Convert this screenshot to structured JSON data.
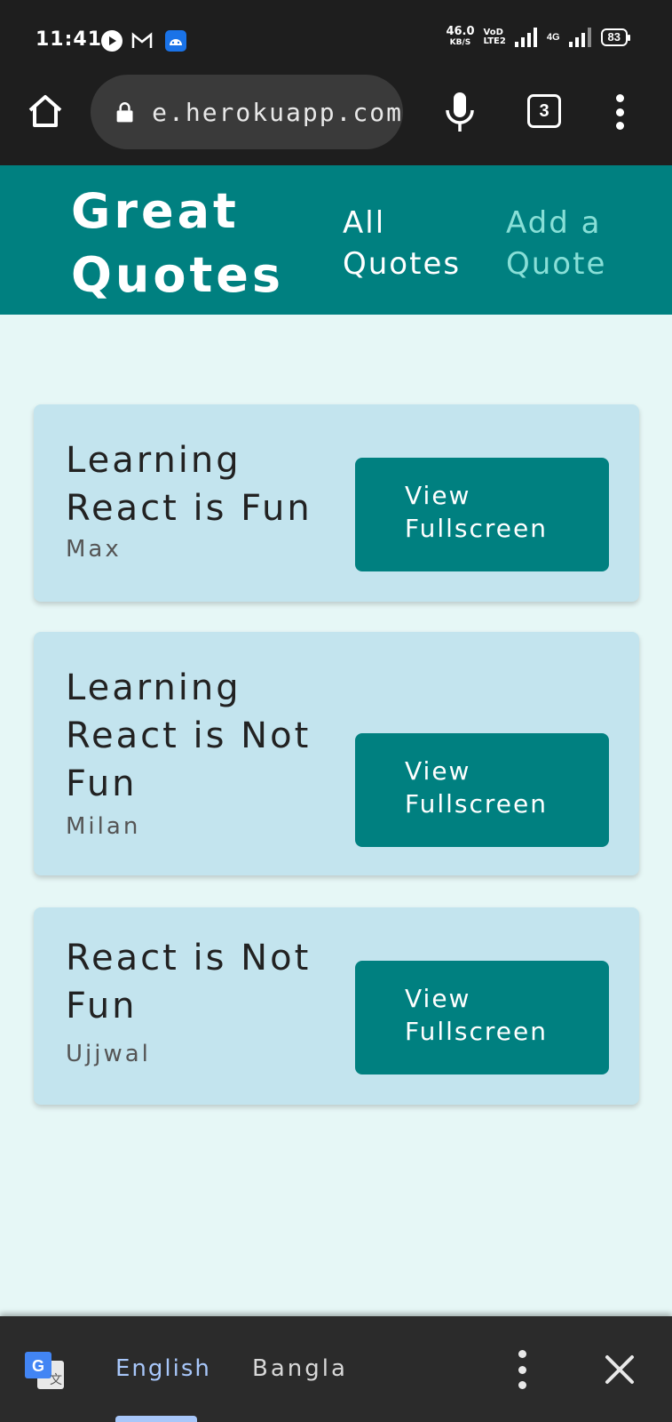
{
  "status_bar": {
    "time": "11:41",
    "net_speed": "46.0",
    "net_unit": "KB/S",
    "volte_top": "VoD",
    "volte_bottom": "LTE2",
    "network": "4G",
    "battery": "83",
    "icons": [
      "play-icon",
      "gmail-icon",
      "android-icon",
      "signal-icon"
    ]
  },
  "browser": {
    "url": "e.herokuapp.com",
    "tab_count": "3",
    "icons": [
      "home-icon",
      "lock-icon",
      "mic-icon",
      "more-vert-icon"
    ]
  },
  "app": {
    "logo": "Great Quotes",
    "nav": {
      "all_quotes": "All Quotes",
      "add_quote": "Add a Quote"
    },
    "colors": {
      "header": "#008080",
      "active_nav": "#88dfd7",
      "card": "#c3e4ee",
      "page_bg": "#e6f7f6"
    }
  },
  "quotes": [
    {
      "text": "Learning React is Fun",
      "author": "Max",
      "button": "View Fullscreen"
    },
    {
      "text": "Learning React is Not Fun",
      "author": "Milan",
      "button": "View Fullscreen"
    },
    {
      "text": "React is Not Fun",
      "author": "Ujjwal",
      "button": "View Fullscreen"
    }
  ],
  "translate_bar": {
    "source_lang": "English",
    "target_lang": "Bangla",
    "icons": [
      "google-translate-icon",
      "more-vert-icon",
      "close-icon"
    ]
  }
}
